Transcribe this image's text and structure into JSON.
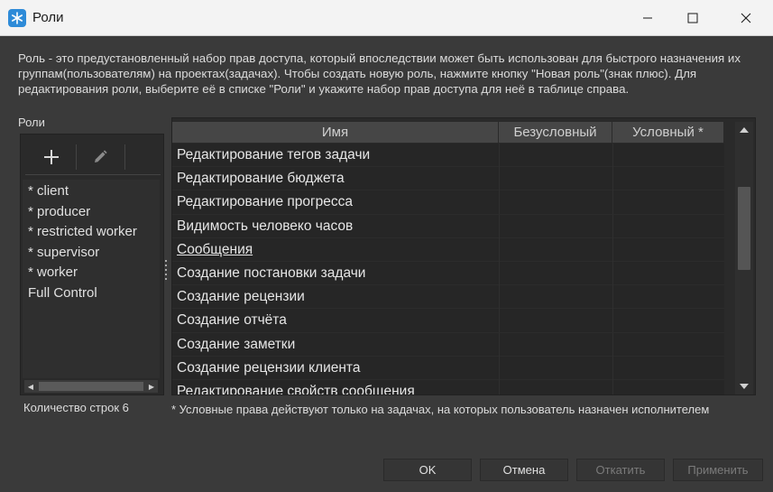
{
  "window": {
    "title": "Роли"
  },
  "description": "Роль - это предустановленный набор прав доступа, который впоследствии может быть использован для быстрого назначения их группам(пользователям) на проектах(задачах). Чтобы создать новую роль, нажмите кнопку \"Новая роль\"(знак плюс). Для редактирования роли, выберите её в списке \"Роли\" и укажите набор прав доступа для неё в таблице справа.",
  "roles": {
    "label": "Роли",
    "items": [
      "* client",
      "* producer",
      "* restricted worker",
      "* supervisor",
      "* worker",
      "Full Control"
    ],
    "row_count": "Количество строк 6"
  },
  "table": {
    "columns": [
      "Имя",
      "Безусловный",
      "Условный *"
    ],
    "rows": [
      {
        "name": "Редактирование тегов задачи",
        "link": false
      },
      {
        "name": "Редактирование бюджета",
        "link": false
      },
      {
        "name": "Редактирование прогресса",
        "link": false
      },
      {
        "name": "Видимость человеко часов",
        "link": false
      },
      {
        "name": "Сообщения",
        "link": true
      },
      {
        "name": "Создание постановки задачи",
        "link": false
      },
      {
        "name": "Создание рецензии",
        "link": false
      },
      {
        "name": "Создание отчёта",
        "link": false
      },
      {
        "name": "Создание заметки",
        "link": false
      },
      {
        "name": "Создание рецензии клиента",
        "link": false
      },
      {
        "name": "Редактирование свойств сообщения",
        "link": false
      }
    ],
    "footnote": "* Условные права действуют только на задачах, на которых пользователь назначен исполнителем"
  },
  "buttons": {
    "ok": "OK",
    "cancel": "Отмена",
    "revert": "Откатить",
    "apply": "Применить"
  },
  "icons": {
    "app": "snowflake-icon",
    "add": "plus-icon",
    "edit": "pencil-icon"
  },
  "colors": {
    "background": "#3a3a3a",
    "titlebar": "#f3f3f3",
    "app_icon": "#2e8bd8"
  }
}
